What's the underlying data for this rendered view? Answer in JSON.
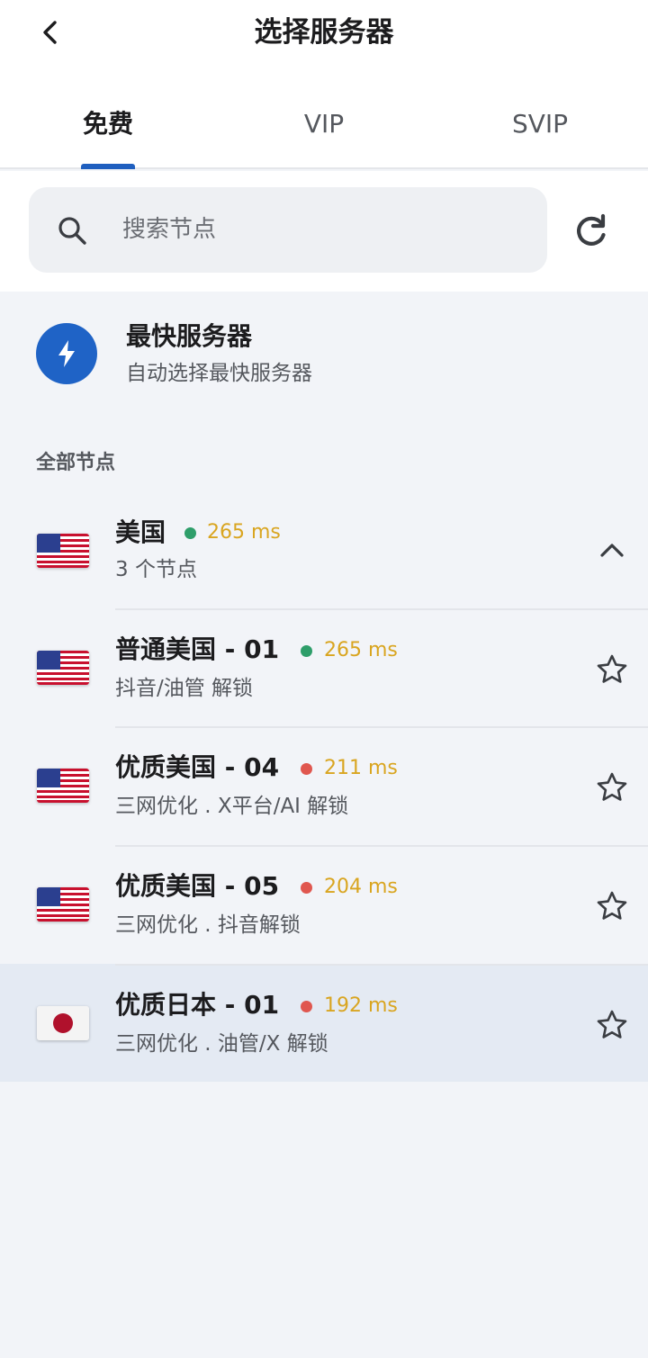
{
  "header": {
    "title": "选择服务器",
    "back_icon": "chevron-left-icon"
  },
  "tabs": [
    {
      "label": "免费",
      "active": true
    },
    {
      "label": "VIP",
      "active": false
    },
    {
      "label": "SVIP",
      "active": false
    }
  ],
  "search": {
    "placeholder": "搜索节点",
    "icon": "search-icon",
    "refresh_icon": "refresh-icon"
  },
  "fastest": {
    "title": "最快服务器",
    "subtitle": "自动选择最快服务器",
    "icon": "lightning-bolt-icon"
  },
  "section_label": "全部节点",
  "country_group": {
    "name": "美国",
    "flag": "us-flag",
    "latency": "265 ms",
    "status_color": "#2e9e6a",
    "node_count": "3 个节点",
    "expanded": true
  },
  "nodes": [
    {
      "name": "普通美国 - 01",
      "flag": "us-flag",
      "latency": "265 ms",
      "status_color": "#2e9e6a",
      "tags": "抖音/油管 解锁",
      "selected": false
    },
    {
      "name": "优质美国 - 04",
      "flag": "us-flag",
      "latency": "211 ms",
      "status_color": "#e0574f",
      "tags": "三网优化 . X平台/AI 解锁",
      "selected": false
    },
    {
      "name": "优质美国 - 05",
      "flag": "us-flag",
      "latency": "204 ms",
      "status_color": "#e0574f",
      "tags": "三网优化 . 抖音解锁",
      "selected": false
    },
    {
      "name": "优质日本 - 01",
      "flag": "jp-flag",
      "latency": "192 ms",
      "status_color": "#e0574f",
      "tags": "三网优化 . 油管/X 解锁",
      "selected": true
    }
  ],
  "colors": {
    "accent": "#1f5fbf",
    "latency_text": "#d9a520",
    "selected_row": "#e4eaf3"
  }
}
